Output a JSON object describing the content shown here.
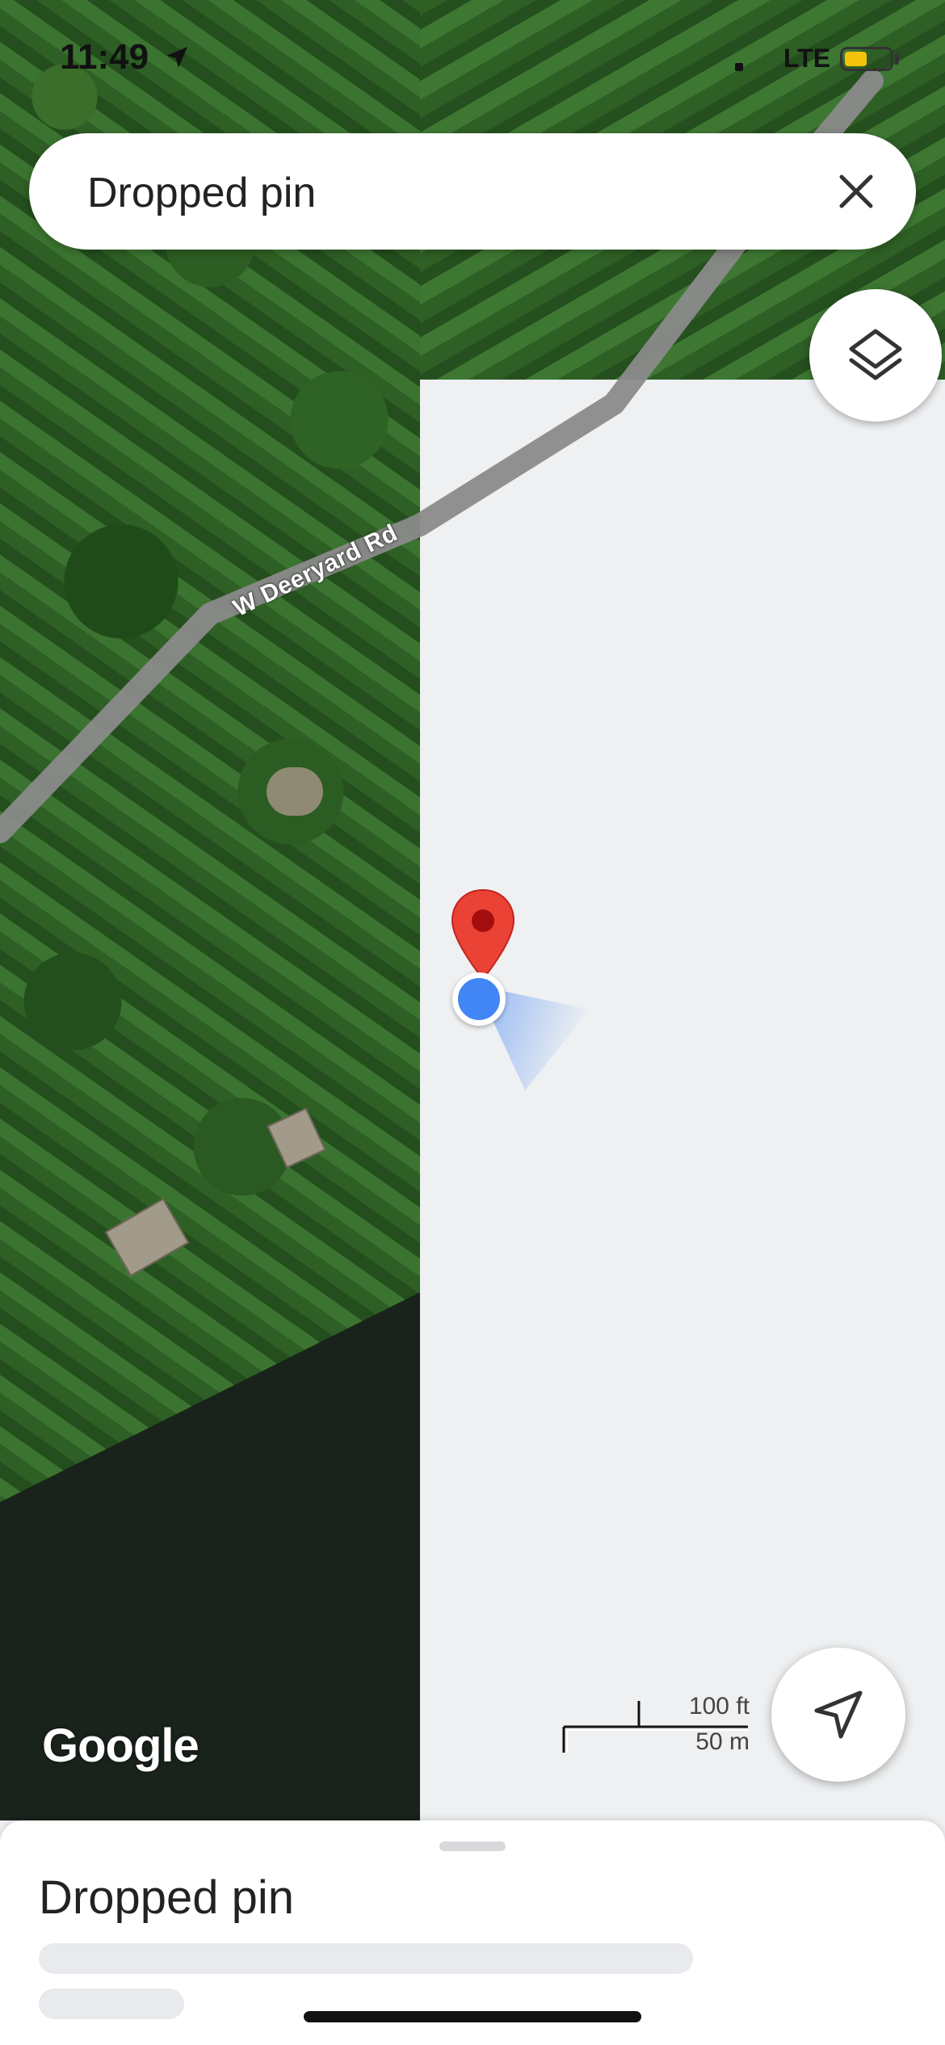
{
  "status_bar": {
    "time": "11:49",
    "network": "LTE",
    "battery_level": 0.5,
    "battery_color": "#f4c20d"
  },
  "search": {
    "query": "Dropped pin",
    "close_icon": "close-icon"
  },
  "map": {
    "road_label": "W Deeryard Rd",
    "attribution": "Google",
    "scale_imperial": "100 ft",
    "scale_metric": "50 m",
    "pin_color": "#ea4335",
    "location_dot_color": "#4285f4"
  },
  "controls": {
    "layers_icon": "layers-icon",
    "locate_icon": "navigation-arrow-icon"
  },
  "bottom_sheet": {
    "title": "Dropped pin"
  }
}
